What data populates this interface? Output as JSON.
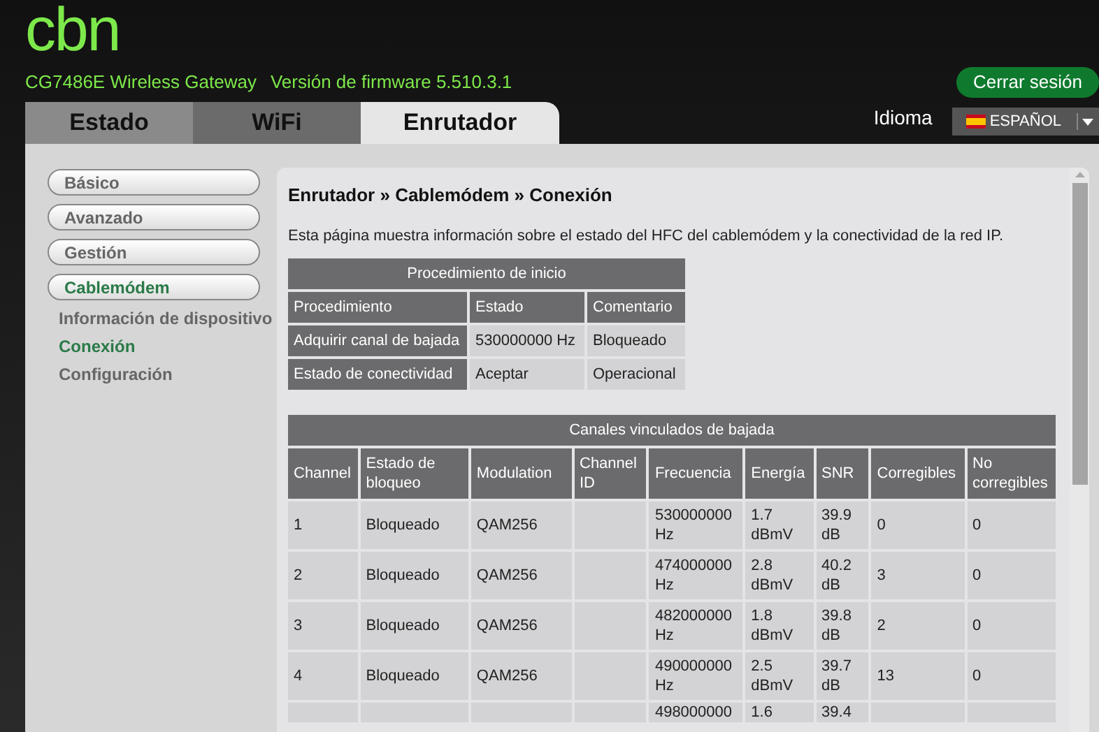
{
  "logo": "cbn",
  "model_info": "CG7486E Wireless Gateway",
  "firmware_info": "Versión de firmware 5.510.3.1",
  "logout_button": "Cerrar sesión",
  "tabs": [
    {
      "label": "Estado",
      "selected": false
    },
    {
      "label": "WiFi",
      "selected": false
    },
    {
      "label": "Enrutador",
      "selected": true
    }
  ],
  "language": {
    "label": "Idioma",
    "value": "ESPAÑOL"
  },
  "sidebar": {
    "items": [
      {
        "label": "Básico",
        "kind": "button",
        "selected": false
      },
      {
        "label": "Avanzado",
        "kind": "button",
        "selected": false
      },
      {
        "label": "Gestión",
        "kind": "button",
        "selected": false
      },
      {
        "label": "Cablemódem",
        "kind": "button",
        "selected": true
      },
      {
        "label": "Información de dispositivo",
        "kind": "link",
        "selected": false
      },
      {
        "label": "Conexión",
        "kind": "link",
        "selected": true
      },
      {
        "label": "Configuración",
        "kind": "link",
        "selected": false
      }
    ]
  },
  "content": {
    "breadcrumb": "Enrutador » Cablemódem » Conexión",
    "description": "Esta página muestra información sobre el estado del HFC del cablemódem y la conectividad de la red IP.",
    "startup_table": {
      "title": "Procedimiento de inicio",
      "columns": [
        "Procedimiento",
        "Estado",
        "Comentario"
      ],
      "rows": [
        [
          "Adquirir canal de bajada",
          "530000000 Hz",
          "Bloqueado"
        ],
        [
          "Estado de conectividad",
          "Aceptar",
          "Operacional"
        ]
      ]
    },
    "downstream_table": {
      "title": "Canales vinculados de bajada",
      "columns": [
        "Channel",
        "Estado de bloqueo",
        "Modulation",
        "Channel ID",
        "Frecuencia",
        "Energía",
        "SNR",
        "Corregibles",
        "No corregibles"
      ],
      "rows": [
        [
          "1",
          "Bloqueado",
          "QAM256",
          "",
          "530000000 Hz",
          "1.7 dBmV",
          "39.9 dB",
          "0",
          "0"
        ],
        [
          "2",
          "Bloqueado",
          "QAM256",
          "",
          "474000000 Hz",
          "2.8 dBmV",
          "40.2 dB",
          "3",
          "0"
        ],
        [
          "3",
          "Bloqueado",
          "QAM256",
          "",
          "482000000 Hz",
          "1.8 dBmV",
          "39.8 dB",
          "2",
          "0"
        ],
        [
          "4",
          "Bloqueado",
          "QAM256",
          "",
          "490000000 Hz",
          "2.5 dBmV",
          "39.7 dB",
          "13",
          "0"
        ],
        [
          "",
          "",
          "",
          "",
          "498000000",
          "1.6",
          "39.4",
          "",
          ""
        ]
      ]
    }
  }
}
